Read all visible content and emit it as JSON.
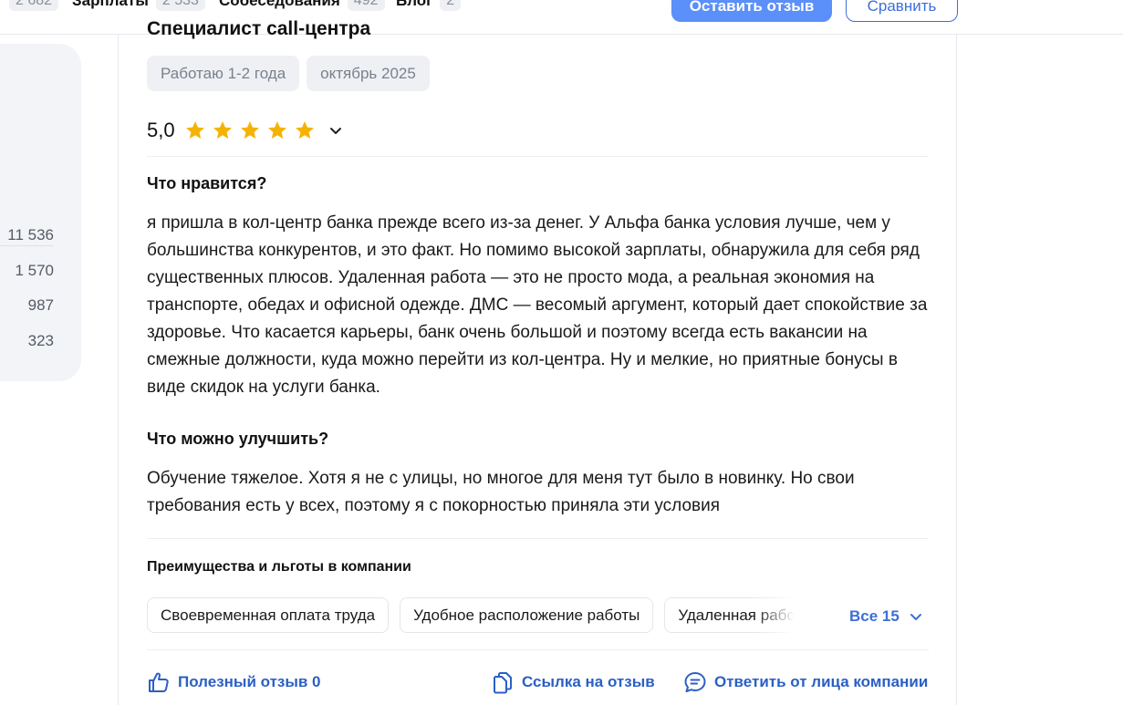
{
  "nav": {
    "items": [
      {
        "label": "",
        "count": "2 682"
      },
      {
        "label": "Зарплаты",
        "count": "2 533"
      },
      {
        "label": "Собеседования",
        "count": "492"
      },
      {
        "label": "Блог",
        "count": "2"
      }
    ],
    "leave_review": "Оставить отзыв",
    "compare": "Сравнить"
  },
  "left_panel": {
    "numbers": [
      "11 536",
      "1 570",
      "987",
      "323"
    ]
  },
  "review": {
    "title": "Специалист call-центра",
    "chips": [
      "Работаю 1-2 года",
      "октябрь 2025"
    ],
    "rating": "5,0",
    "stars": 5,
    "likes_title": "Что нравится?",
    "likes_text": "я пришла в кол-центр банка прежде всего из-за денег. У Альфа банка условия лучше, чем у большинства конкурентов, и это факт. Но помимо высокой зарплаты, обнаружила для себя ряд существенных плюсов. Удаленная работа — это не просто мода, а реальная экономия на транспорте, обедах и офисной одежде. ДМС — весомый аргумент, который дает спокойствие за здоровье. Что касается карьеры, банк очень большой и поэтому всегда есть вакансии на смежные должности, куда можно перейти из кол-центра. Ну и мелкие, но приятные бонусы в виде скидок на услуги банка.",
    "improve_title": "Что можно улучшить?",
    "improve_text": "Обучение тяжелое. Хотя я не с улицы, но многое для меня тут было в новинку. Но свои требования есть у всех, поэтому я с покорностью приняла эти условия",
    "benefits_title": "Преимущества и льготы в компании",
    "benefits": [
      "Своевременная оплата труда",
      "Удобное расположение работы",
      "Удаленная работа"
    ],
    "benefits_all": "Все 15",
    "helpful": "Полезный отзыв 0",
    "link": "Ссылка на отзыв",
    "reply": "Ответить от лица компании"
  },
  "colors": {
    "accent": "#3d6fd6",
    "primary_button": "#5b8ff9",
    "star": "#f5b301",
    "chip_bg": "#eef0f4"
  }
}
